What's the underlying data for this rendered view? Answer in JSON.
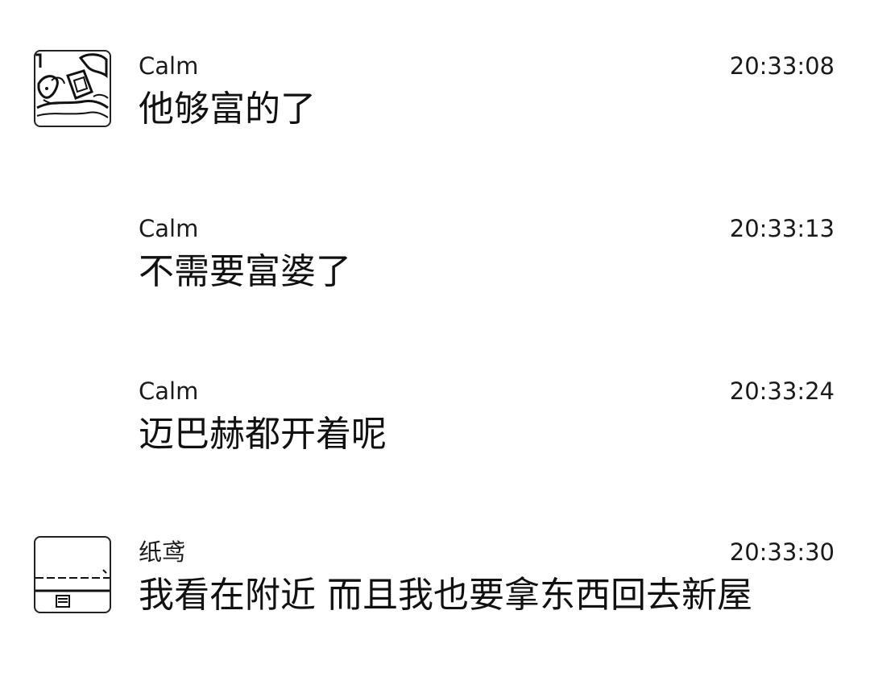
{
  "messages": [
    {
      "sender": "Calm",
      "time": "20:33:08",
      "text": "他够富的了",
      "avatar": "calm-avatar"
    },
    {
      "sender": "Calm",
      "time": "20:33:13",
      "text": "不需要富婆了",
      "avatar": null
    },
    {
      "sender": "Calm",
      "time": "20:33:24",
      "text": "迈巴赫都开着呢",
      "avatar": null
    },
    {
      "sender": "纸鸢",
      "time": "20:33:30",
      "text": "我看在附近 而且我也要拿东西回去新屋",
      "avatar": "zhiyuan-avatar"
    }
  ]
}
